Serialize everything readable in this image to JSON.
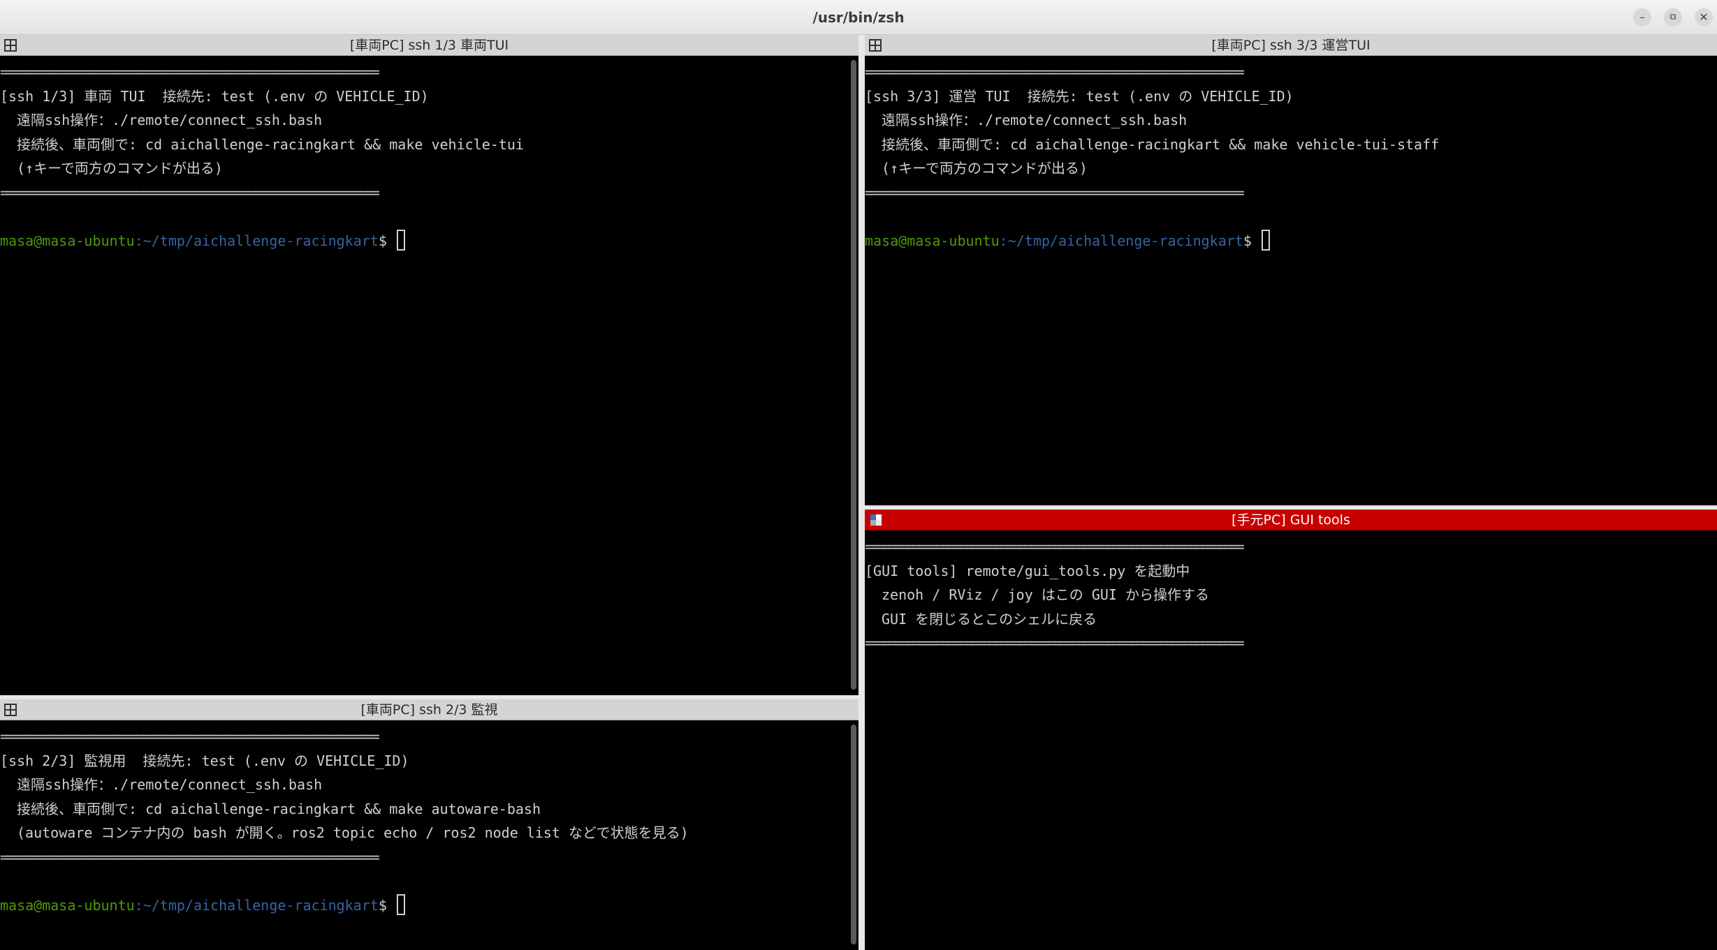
{
  "window": {
    "title": "/usr/bin/zsh",
    "controls": {
      "minimize": "–",
      "maximize": "⧉",
      "close": "✕"
    }
  },
  "panes": {
    "vehicle_tui": {
      "title": "[車両PC] ssh 1/3 車両TUI",
      "lines": {
        "rule1": "================================================================",
        "l1": "[ssh 1/3] 車両 TUI  接続先: test (.env の VEHICLE_ID)",
        "l2": "遠隔ssh操作：./remote/connect_ssh.bash",
        "l3": "接続後、車両側で: cd aichallenge-racingkart && make vehicle-tui",
        "l4": "(↑キーで両方のコマンドが出る)",
        "rule2": "================================================================"
      },
      "prompt": {
        "user": "masa@masa-ubuntu",
        "path": ":~/tmp/aichallenge-racingkart",
        "symbol": "$"
      }
    },
    "monitor": {
      "title": "[車両PC] ssh 2/3 監視",
      "lines": {
        "rule1": "================================================================",
        "l1": "[ssh 2/3] 監視用  接続先: test (.env の VEHICLE_ID)",
        "l2": "遠隔ssh操作：./remote/connect_ssh.bash",
        "l3": "接続後、車両側で: cd aichallenge-racingkart && make autoware-bash",
        "l4": "(autoware コンテナ内の bash が開く。ros2 topic echo / ros2 node list などで状態を見る)",
        "rule2": "================================================================"
      },
      "prompt": {
        "user": "masa@masa-ubuntu",
        "path": ":~/tmp/aichallenge-racingkart",
        "symbol": "$"
      }
    },
    "staff_tui": {
      "title": "[車両PC] ssh 3/3 運営TUI",
      "lines": {
        "rule1": "================================================================",
        "l1": "[ssh 3/3] 運営 TUI  接続先: test (.env の VEHICLE_ID)",
        "l2": "遠隔ssh操作：./remote/connect_ssh.bash",
        "l3": "接続後、車両側で: cd aichallenge-racingkart && make vehicle-tui-staff",
        "l4": "(↑キーで両方のコマンドが出る)",
        "rule2": "================================================================"
      },
      "prompt": {
        "user": "masa@masa-ubuntu",
        "path": ":~/tmp/aichallenge-racingkart",
        "symbol": "$"
      }
    },
    "gui_tools": {
      "title": "[手元PC] GUI tools",
      "lines": {
        "rule1": "================================================================",
        "l1": "[GUI tools] remote/gui_tools.py を起動中",
        "l2": "zenoh / RViz / joy はこの GUI から操作する",
        "l3": "GUI を閉じるとこのシェルに戻る",
        "rule2": "================================================================"
      }
    }
  },
  "colors": {
    "active_pane_bar": "#c70000",
    "prompt_user": "#4e9a06",
    "prompt_path": "#3465a4"
  }
}
